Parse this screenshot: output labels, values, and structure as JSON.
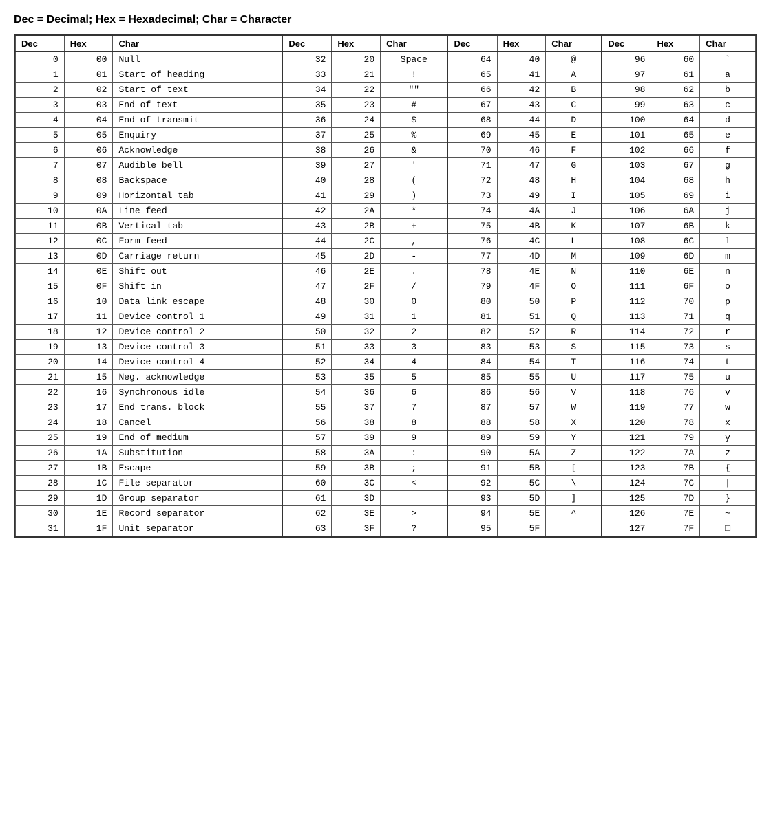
{
  "title": "Dec = Decimal; Hex = Hexadecimal; Char = Character",
  "headers": [
    "Dec",
    "Hex",
    "Char",
    "Dec",
    "Hex",
    "Char",
    "Dec",
    "Hex",
    "Char",
    "Dec",
    "Hex",
    "Char"
  ],
  "rows": [
    [
      0,
      "00",
      "Null",
      32,
      "20",
      "Space",
      64,
      "40",
      "@",
      96,
      "60",
      "`"
    ],
    [
      1,
      "01",
      "Start of heading",
      33,
      "21",
      "!",
      65,
      "41",
      "A",
      97,
      "61",
      "a"
    ],
    [
      2,
      "02",
      "Start of text",
      34,
      "22",
      "\"\"",
      66,
      "42",
      "B",
      98,
      "62",
      "b"
    ],
    [
      3,
      "03",
      "End of text",
      35,
      "23",
      "#",
      67,
      "43",
      "C",
      99,
      "63",
      "c"
    ],
    [
      4,
      "04",
      "End of transmit",
      36,
      "24",
      "$",
      68,
      "44",
      "D",
      100,
      "64",
      "d"
    ],
    [
      5,
      "05",
      "Enquiry",
      37,
      "25",
      "%",
      69,
      "45",
      "E",
      101,
      "65",
      "e"
    ],
    [
      6,
      "06",
      "Acknowledge",
      38,
      "26",
      "&",
      70,
      "46",
      "F",
      102,
      "66",
      "f"
    ],
    [
      7,
      "07",
      "Audible bell",
      39,
      "27",
      "'",
      71,
      "47",
      "G",
      103,
      "67",
      "g"
    ],
    [
      8,
      "08",
      "Backspace",
      40,
      "28",
      "(",
      72,
      "48",
      "H",
      104,
      "68",
      "h"
    ],
    [
      9,
      "09",
      "Horizontal tab",
      41,
      "29",
      ")",
      73,
      "49",
      "I",
      105,
      "69",
      "i"
    ],
    [
      10,
      "0A",
      "Line feed",
      42,
      "2A",
      "*",
      74,
      "4A",
      "J",
      106,
      "6A",
      "j"
    ],
    [
      11,
      "0B",
      "Vertical tab",
      43,
      "2B",
      "+",
      75,
      "4B",
      "K",
      107,
      "6B",
      "k"
    ],
    [
      12,
      "0C",
      "Form feed",
      44,
      "2C",
      ",",
      76,
      "4C",
      "L",
      108,
      "6C",
      "l"
    ],
    [
      13,
      "0D",
      "Carriage return",
      45,
      "2D",
      "-",
      77,
      "4D",
      "M",
      109,
      "6D",
      "m"
    ],
    [
      14,
      "0E",
      "Shift out",
      46,
      "2E",
      ".",
      78,
      "4E",
      "N",
      110,
      "6E",
      "n"
    ],
    [
      15,
      "0F",
      "Shift in",
      47,
      "2F",
      "/",
      79,
      "4F",
      "O",
      111,
      "6F",
      "o"
    ],
    [
      16,
      "10",
      "Data link escape",
      48,
      "30",
      "0",
      80,
      "50",
      "P",
      112,
      "70",
      "p"
    ],
    [
      17,
      "11",
      "Device control 1",
      49,
      "31",
      "1",
      81,
      "51",
      "Q",
      113,
      "71",
      "q"
    ],
    [
      18,
      "12",
      "Device control 2",
      50,
      "32",
      "2",
      82,
      "52",
      "R",
      114,
      "72",
      "r"
    ],
    [
      19,
      "13",
      "Device control 3",
      51,
      "33",
      "3",
      83,
      "53",
      "S",
      115,
      "73",
      "s"
    ],
    [
      20,
      "14",
      "Device control 4",
      52,
      "34",
      "4",
      84,
      "54",
      "T",
      116,
      "74",
      "t"
    ],
    [
      21,
      "15",
      "Neg. acknowledge",
      53,
      "35",
      "5",
      85,
      "55",
      "U",
      117,
      "75",
      "u"
    ],
    [
      22,
      "16",
      "Synchronous idle",
      54,
      "36",
      "6",
      86,
      "56",
      "V",
      118,
      "76",
      "v"
    ],
    [
      23,
      "17",
      "End trans. block",
      55,
      "37",
      "7",
      87,
      "57",
      "W",
      119,
      "77",
      "w"
    ],
    [
      24,
      "18",
      "Cancel",
      56,
      "38",
      "8",
      88,
      "58",
      "X",
      120,
      "78",
      "x"
    ],
    [
      25,
      "19",
      "End of medium",
      57,
      "39",
      "9",
      89,
      "59",
      "Y",
      121,
      "79",
      "y"
    ],
    [
      26,
      "1A",
      "Substitution",
      58,
      "3A",
      ":",
      90,
      "5A",
      "Z",
      122,
      "7A",
      "z"
    ],
    [
      27,
      "1B",
      "Escape",
      59,
      "3B",
      ";",
      91,
      "5B",
      "[",
      123,
      "7B",
      "{"
    ],
    [
      28,
      "1C",
      "File separator",
      60,
      "3C",
      "<",
      92,
      "5C",
      "\\",
      124,
      "7C",
      "|"
    ],
    [
      29,
      "1D",
      "Group separator",
      61,
      "3D",
      "=",
      93,
      "5D",
      "]",
      125,
      "7D",
      "}"
    ],
    [
      30,
      "1E",
      "Record separator",
      62,
      "3E",
      ">",
      94,
      "5E",
      "^",
      126,
      "7E",
      "~"
    ],
    [
      31,
      "1F",
      "Unit separator",
      63,
      "3F",
      "?",
      95,
      "5F",
      "",
      127,
      "7F",
      "□"
    ]
  ]
}
